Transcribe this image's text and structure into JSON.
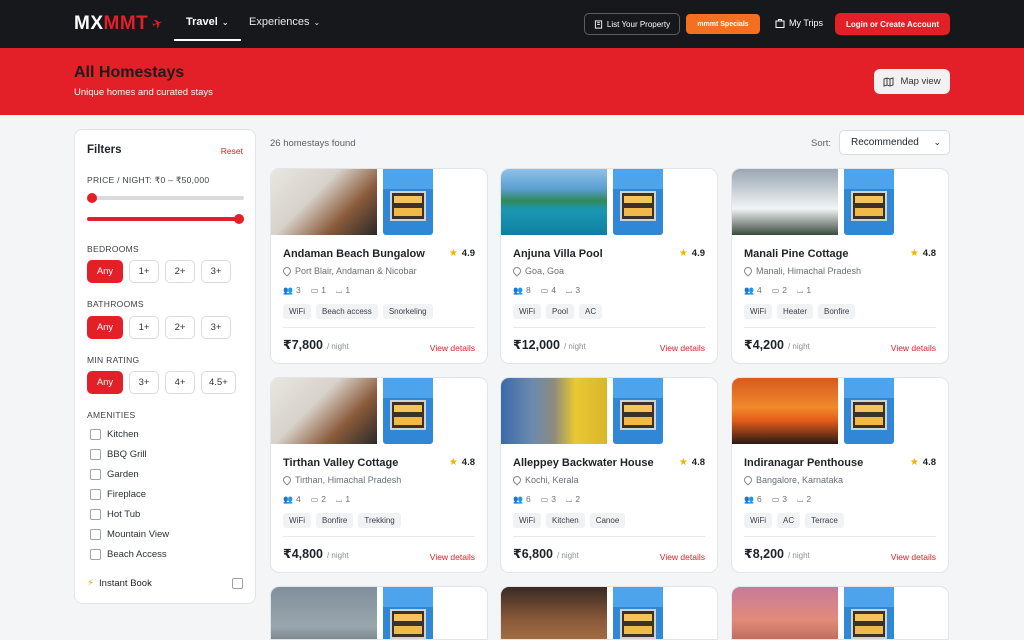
{
  "nav": {
    "logo_a": "MX",
    "logo_b": "MMT",
    "travel": "Travel",
    "experiences": "Experiences",
    "list_property": "List Your Property",
    "specials": "mmmt Specials",
    "my_trips": "My Trips",
    "login": "Login or Create Account"
  },
  "hero": {
    "title": "All Homestays",
    "subtitle": "Unique homes and curated stays",
    "map_view": "Map view"
  },
  "filters": {
    "title": "Filters",
    "reset": "Reset",
    "price_label": "PRICE / NIGHT: ₹0 – ₹50,000",
    "bedrooms_label": "BEDROOMS",
    "bedrooms": [
      "Any",
      "1+",
      "2+",
      "3+"
    ],
    "bathrooms_label": "BATHROOMS",
    "bathrooms": [
      "Any",
      "1+",
      "2+",
      "3+"
    ],
    "rating_label": "MIN RATING",
    "ratings": [
      "Any",
      "3+",
      "4+",
      "4.5+"
    ],
    "amenities_label": "AMENITIES",
    "amenities": [
      "Kitchen",
      "BBQ Grill",
      "Garden",
      "Fireplace",
      "Hot Tub",
      "Mountain View",
      "Beach Access"
    ],
    "instant_book": "Instant Book"
  },
  "results": {
    "count": "26 homestays found",
    "sort_label": "Sort:",
    "sort_value": "Recommended"
  },
  "cards": [
    {
      "name": "Andaman Beach Bungalow",
      "rating": "4.9",
      "location": "Port Blair, Andaman & Nicobar",
      "guests": "3",
      "beds": "1",
      "baths": "1",
      "tags": [
        "WiFi",
        "Beach access",
        "Snorkeling"
      ],
      "price": "₹7,800",
      "per": "/ night",
      "cta": "View details"
    },
    {
      "name": "Anjuna Villa Pool",
      "rating": "4.9",
      "location": "Goa, Goa",
      "guests": "8",
      "beds": "4",
      "baths": "3",
      "tags": [
        "WiFi",
        "Pool",
        "AC"
      ],
      "price": "₹12,000",
      "per": "/ night",
      "cta": "View details"
    },
    {
      "name": "Manali Pine Cottage",
      "rating": "4.8",
      "location": "Manali, Himachal Pradesh",
      "guests": "4",
      "beds": "2",
      "baths": "1",
      "tags": [
        "WiFi",
        "Heater",
        "Bonfire"
      ],
      "price": "₹4,200",
      "per": "/ night",
      "cta": "View details"
    },
    {
      "name": "Tirthan Valley Cottage",
      "rating": "4.8",
      "location": "Tirthan, Himachal Pradesh",
      "guests": "4",
      "beds": "2",
      "baths": "1",
      "tags": [
        "WiFi",
        "Bonfire",
        "Trekking"
      ],
      "price": "₹4,800",
      "per": "/ night",
      "cta": "View details"
    },
    {
      "name": "Alleppey Backwater House",
      "rating": "4.8",
      "location": "Kochi, Kerala",
      "guests": "6",
      "beds": "3",
      "baths": "2",
      "tags": [
        "WiFi",
        "Kitchen",
        "Canoe"
      ],
      "price": "₹6,800",
      "per": "/ night",
      "cta": "View details"
    },
    {
      "name": "Indiranagar Penthouse",
      "rating": "4.8",
      "location": "Bangalore, Karnataka",
      "guests": "6",
      "beds": "3",
      "baths": "2",
      "tags": [
        "WiFi",
        "AC",
        "Terrace"
      ],
      "price": "₹8,200",
      "per": "/ night",
      "cta": "View details"
    }
  ],
  "colors": {
    "brand": "#e32027",
    "nav_bg": "#17181b",
    "specials": "#f37021",
    "star": "#f0b400"
  }
}
